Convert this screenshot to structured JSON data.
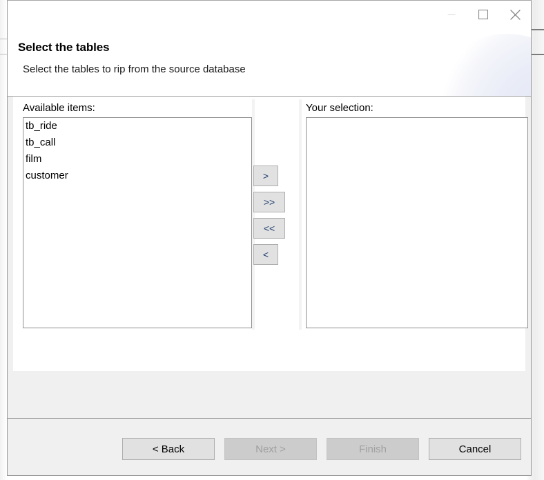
{
  "window": {
    "icon_name": "app-icon-red-asterisk",
    "icon_color": "#cc1111",
    "title": "",
    "controls": {
      "minimize_label": "—",
      "maximize_label": "□",
      "close_label": "✕"
    }
  },
  "header": {
    "title": "Select the tables",
    "subtitle": "Select the tables to rip from the source database"
  },
  "main": {
    "available": {
      "label": "Available items:",
      "items": [
        {
          "name": "tb_ride",
          "selected": false
        },
        {
          "name": "tb_call",
          "selected": false
        },
        {
          "name": "film",
          "selected": false
        },
        {
          "name": "customer",
          "selected": false
        }
      ]
    },
    "selection": {
      "label": "Your selection:",
      "items": []
    },
    "transfer_buttons": [
      {
        "label": ">",
        "name": "add-selected-button",
        "width": "narrow",
        "enabled": true
      },
      {
        "label": ">>",
        "name": "add-all-button",
        "width": "wide",
        "enabled": true
      },
      {
        "label": "<<",
        "name": "remove-all-button",
        "width": "wide",
        "enabled": true
      },
      {
        "label": "<",
        "name": "remove-selected-button",
        "width": "narrow",
        "enabled": true
      }
    ]
  },
  "footer": {
    "buttons": [
      {
        "label": "< Back",
        "name": "back-button",
        "enabled": true
      },
      {
        "label": "Next >",
        "name": "next-button",
        "enabled": false
      },
      {
        "label": "Finish",
        "name": "finish-button",
        "enabled": false
      },
      {
        "label": "Cancel",
        "name": "cancel-button",
        "enabled": true
      }
    ]
  },
  "colors": {
    "accent_red": "#cc1111",
    "chevron_blue": "#1d3c6e",
    "dialog_bg": "#f0f0f0",
    "content_bg": "#ffffff",
    "border": "#8d8d8d"
  }
}
